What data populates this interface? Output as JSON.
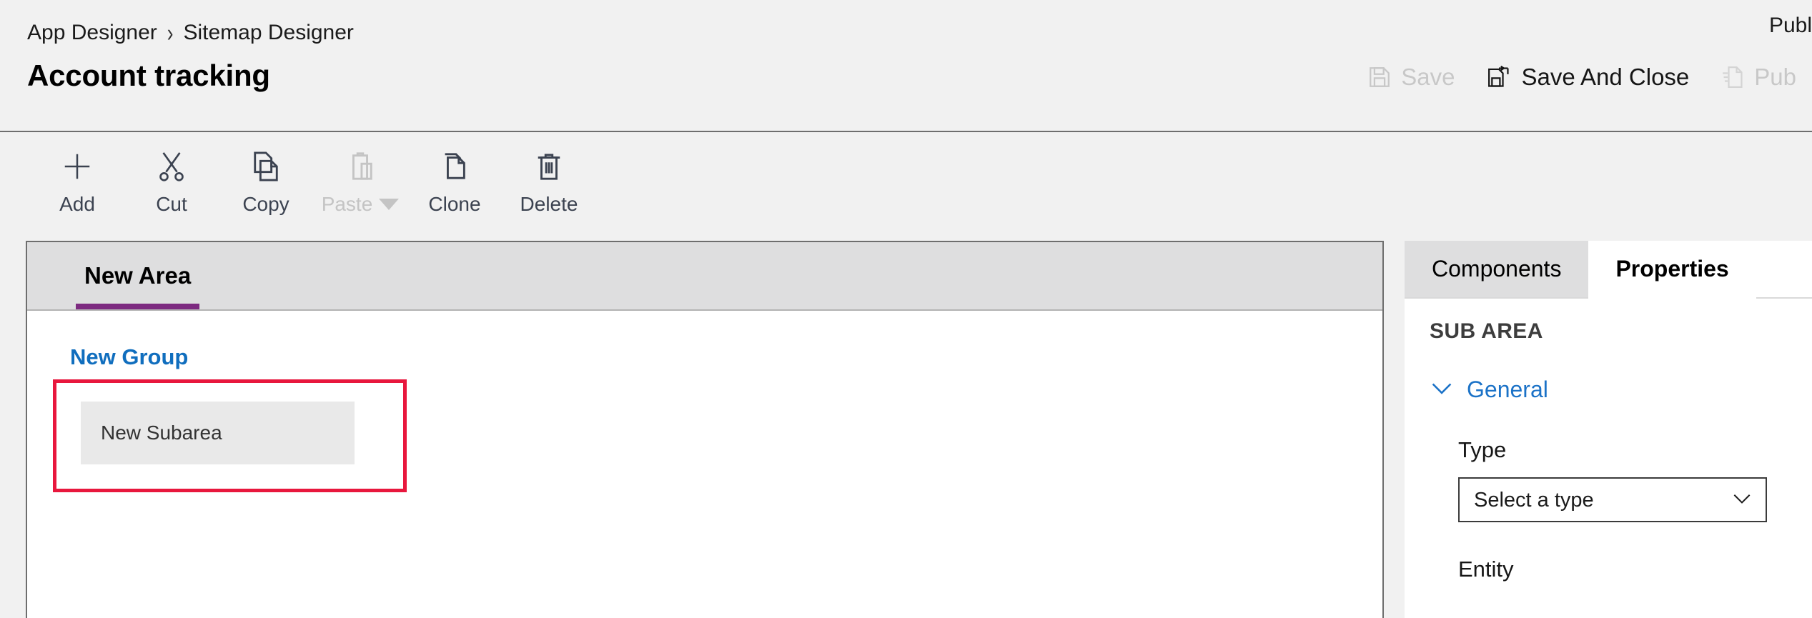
{
  "header": {
    "breadcrumb": [
      {
        "label": "App Designer"
      },
      {
        "label": "Sitemap Designer"
      }
    ],
    "breadcrumb_separator": "›",
    "title": "Account tracking",
    "publish_overflow_label": "Publ",
    "commands": [
      {
        "id": "save",
        "label": "Save",
        "icon": "save-icon",
        "disabled": true
      },
      {
        "id": "save_and_close",
        "label": "Save And Close",
        "icon": "save-and-close-icon",
        "disabled": false
      },
      {
        "id": "publish",
        "label": "Pub",
        "icon": "publish-icon",
        "disabled": true
      }
    ]
  },
  "toolbar": {
    "buttons": [
      {
        "id": "add",
        "label": "Add",
        "icon": "plus-icon",
        "disabled": false,
        "has_caret": false
      },
      {
        "id": "cut",
        "label": "Cut",
        "icon": "scissors-icon",
        "disabled": false,
        "has_caret": false
      },
      {
        "id": "copy",
        "label": "Copy",
        "icon": "copy-icon",
        "disabled": false,
        "has_caret": false
      },
      {
        "id": "paste",
        "label": "Paste",
        "icon": "clipboard-icon",
        "disabled": true,
        "has_caret": true
      },
      {
        "id": "clone",
        "label": "Clone",
        "icon": "clone-icon",
        "disabled": false,
        "has_caret": false
      },
      {
        "id": "delete",
        "label": "Delete",
        "icon": "trash-icon",
        "disabled": false,
        "has_caret": false
      }
    ]
  },
  "canvas": {
    "area_tabs": [
      {
        "label": "New Area",
        "active": true
      }
    ],
    "group": {
      "label": "New Group"
    },
    "subarea": {
      "label": "New Subarea",
      "selected": true
    }
  },
  "properties_panel": {
    "tabs": [
      {
        "label": "Components",
        "active": false
      },
      {
        "label": "Properties",
        "active": true
      }
    ],
    "heading": "SUB AREA",
    "sections": [
      {
        "label": "General",
        "expanded": true,
        "fields": [
          {
            "label": "Type",
            "control": "select",
            "value": "Select a type"
          },
          {
            "label": "Entity",
            "control": "select",
            "value": ""
          }
        ]
      }
    ]
  },
  "colors": {
    "accent_purple": "#7d2a80",
    "link_blue": "#106ebe",
    "section_blue": "#1b72c7",
    "selection_red": "#e8173d",
    "chrome_gray": "#f1f1f1",
    "tab_gray": "#dededf",
    "subarea_gray": "#e9e9e9"
  }
}
